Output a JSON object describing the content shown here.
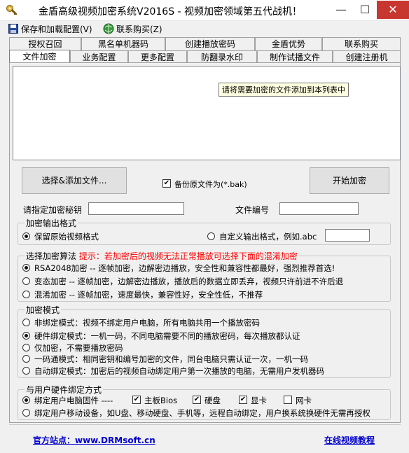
{
  "window": {
    "title": "金盾高级视频加密系统V2016S - 视频加密领域第五代战机！",
    "minimize_glyph": "—",
    "maximize_glyph": "☐",
    "close_glyph": "✕"
  },
  "menu": {
    "save_load": "保存和加载配置(V)",
    "contact_buy": "联系购买(Z)"
  },
  "tabs_row1": [
    "授权召回",
    "黑名单机器码",
    "创建播放密码",
    "金盾优势",
    "联系购买"
  ],
  "tabs_row2": [
    "文件加密",
    "业务配置",
    "更多配置",
    "防翻录水印",
    "制作试播文件",
    "创建注册机"
  ],
  "file_list": {
    "tooltip": "请将需要加密的文件添加到本列表中"
  },
  "actions": {
    "add_files": "选择&添加文件...",
    "backup_label": "备份原文件为(*.bak)",
    "backup_checked": true,
    "start_encrypt": "开始加密"
  },
  "fields": {
    "key_label": "请指定加密秘钥",
    "key_value": "",
    "file_no_label": "文件编号",
    "file_no_value": ""
  },
  "output_format": {
    "title": "加密输出格式",
    "keep_original": "保留原始视频格式",
    "custom": "自定义输出格式，例如.abc",
    "custom_value": "",
    "selected": "keep_original"
  },
  "algorithm": {
    "title": "选择加密算法",
    "hint": "提示：若加密后的视频无法正常播放可选择下面的混淆加密",
    "options": [
      "RSA2048加密 --  逐帧加密，边解密边播放，安全性和兼容性都最好，强烈推荐首选!",
      "变态加密 -- 逐帧加密，边解密边播放，播放后的数据立即丢弃，视频只许前进不许后退",
      "混淆加密 -- 逐帧加密，速度最快，兼容性好，安全性低，不推荐"
    ],
    "selected_index": 0
  },
  "mode": {
    "title": "加密模式",
    "options": [
      "非绑定模式：视频不绑定用户电脑，所有电脑共用一个播放密码",
      "硬件绑定模式：一机一码，不同电脑需要不同的播放密码，每次播放都认证",
      "仅加密，不需要播放密码",
      "一码通模式：相同密钥和编号加密的文件，同台电脑只需认证一次，一机一码",
      "自动绑定模式：加密后的视频自动绑定用户第一次播放的电脑，无需用户发机器码"
    ],
    "selected_index": 1
  },
  "binding": {
    "title": "与用户硬件绑定方式",
    "option1": "绑定用户电脑固件 ----",
    "hardware": [
      {
        "label": "主板Bios",
        "checked": true
      },
      {
        "label": "硬盘",
        "checked": true
      },
      {
        "label": "显卡",
        "checked": true
      },
      {
        "label": "网卡",
        "checked": false
      }
    ],
    "option2": "绑定用户移动设备，如U盘、移动硬盘、手机等，远程自动绑定，用户换系统换硬件无需再授权",
    "selected_index": 0
  },
  "footer": {
    "site": "官方站点：www.DRMsoft.cn",
    "tutorial": "在线视频教程"
  }
}
